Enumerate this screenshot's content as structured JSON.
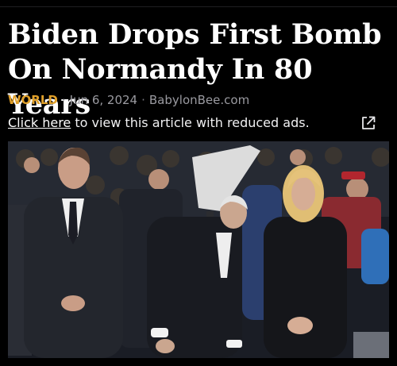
{
  "article": {
    "title": "Biden Drops First Bomb On Normandy In 80 Years",
    "section": "WORLD",
    "separator": "·",
    "date": "Jun 6, 2024",
    "source": "BabylonBee.com"
  },
  "reduced_ads": {
    "link_text": "Click here",
    "rest_text": " to view this article with reduced ads."
  },
  "icons": {
    "external": "external-link-icon"
  },
  "colors": {
    "background": "#000000",
    "section": "#e0a02a",
    "meta": "#9a9aa0"
  }
}
